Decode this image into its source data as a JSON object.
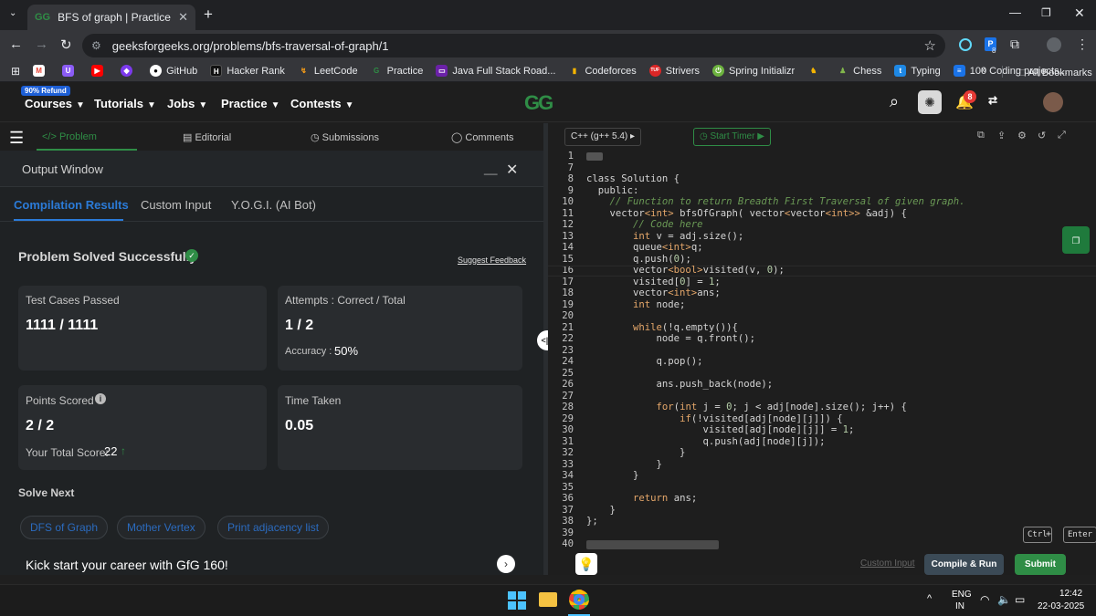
{
  "browser": {
    "tab_title": "BFS of graph | Practice | Geeksfo",
    "url": "geeksforgeeks.org/problems/bfs-traversal-of-graph/1",
    "bookmarks": [
      "GitHub",
      "Hacker Rank",
      "LeetCode",
      "Practice",
      "Java Full Stack Road...",
      "Codeforces",
      "Strivers",
      "Spring Initializr",
      "",
      "Chess",
      "Typing",
      "100 Coding projects..."
    ],
    "all_bookmarks": "All Bookmarks",
    "badge_count": "8"
  },
  "site": {
    "refund_badge": "90% Refund",
    "nav": [
      "Courses",
      "Tutorials",
      "Jobs",
      "Practice",
      "Contests"
    ],
    "notif_count": "8",
    "logo_text": "GG"
  },
  "problem_tabs": [
    "Problem",
    "Editorial",
    "Submissions",
    "Comments"
  ],
  "output": {
    "title": "Output Window",
    "tabs": [
      "Compilation Results",
      "Custom Input",
      "Y.O.G.I. (AI Bot)"
    ],
    "status": "Problem Solved Successfully",
    "suggest_feedback": "Suggest Feedback",
    "test_cases_label": "Test Cases Passed",
    "test_cases_value": "1111 / 1111",
    "attempts_label": "Attempts : Correct / Total",
    "attempts_value": "1 / 2",
    "accuracy_label": "Accuracy :",
    "accuracy_value": "50%",
    "points_label": "Points Scored",
    "points_value": "2 / 2",
    "total_score_label": "Your Total Score:",
    "total_score_value": "22",
    "time_label": "Time Taken",
    "time_value": "0.05",
    "solve_next_label": "Solve Next",
    "solve_next": [
      "DFS of Graph",
      "Mother Vertex",
      "Print adjacency list"
    ],
    "kickstart": "Kick start your career with GfG 160!"
  },
  "editor": {
    "language": "C++ (g++ 5.4)",
    "start_timer": "Start Timer",
    "line_numbers": [
      "1",
      "7",
      "8",
      "9",
      "10",
      "11",
      "12",
      "13",
      "14",
      "15",
      "16",
      "17",
      "18",
      "19",
      "20",
      "21",
      "22",
      "23",
      "24",
      "25",
      "26",
      "27",
      "28",
      "29",
      "30",
      "31",
      "32",
      "33",
      "34",
      "35",
      "36",
      "37",
      "38",
      "39",
      "40"
    ],
    "custom_input": "Custom Input",
    "compile_run": "Compile & Run",
    "submit": "Submit",
    "shortcut_ctrl": "Ctrl",
    "shortcut_plus": "+",
    "shortcut_enter": "Enter"
  },
  "taskbar": {
    "lang1": "ENG",
    "lang2": "IN",
    "time": "12:42",
    "date": "22-03-2025"
  }
}
